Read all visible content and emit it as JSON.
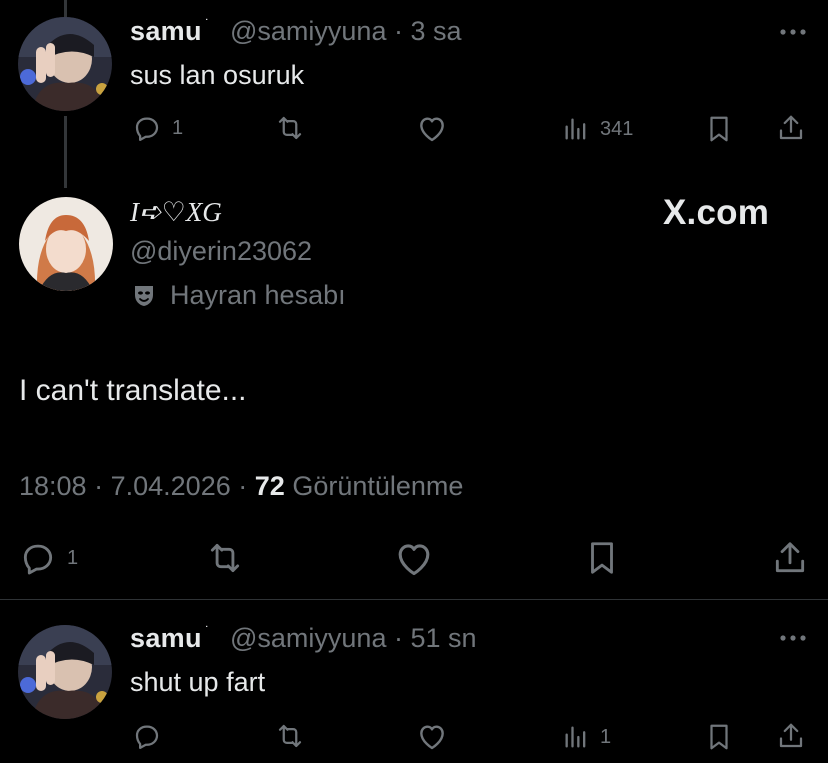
{
  "reply_top": {
    "name": "samu",
    "name_mark": "˙",
    "handle": "@samiyyuna",
    "separator": "·",
    "time": "3 sa",
    "text": "sus lan osuruk",
    "actions": {
      "reply_count": "1",
      "repost_count": "",
      "like_count": "",
      "views_count": "341"
    }
  },
  "main_tweet": {
    "name": "I➪♡XG",
    "handle": "@diyerin23062",
    "label_icon": "theater-mask-icon",
    "label": "Hayran hesabı",
    "brand": "X.com",
    "text": "I can't translate...",
    "time": "18:08",
    "separator": "·",
    "date": "7.04.2026",
    "views": "72",
    "views_label": "Görüntülenme",
    "actions": {
      "reply_count": "1"
    }
  },
  "reply_bottom": {
    "name": "samu",
    "name_mark": "˙",
    "handle": "@samiyyuna",
    "separator": "·",
    "time": "51 sn",
    "text": "shut up fart",
    "actions": {
      "reply_count": "",
      "repost_count": "",
      "like_count": "",
      "views_count": "1"
    }
  },
  "colors": {
    "background": "#000000",
    "text_primary": "#e7e9ea",
    "text_secondary": "#71767b",
    "divider": "#2f3336"
  }
}
